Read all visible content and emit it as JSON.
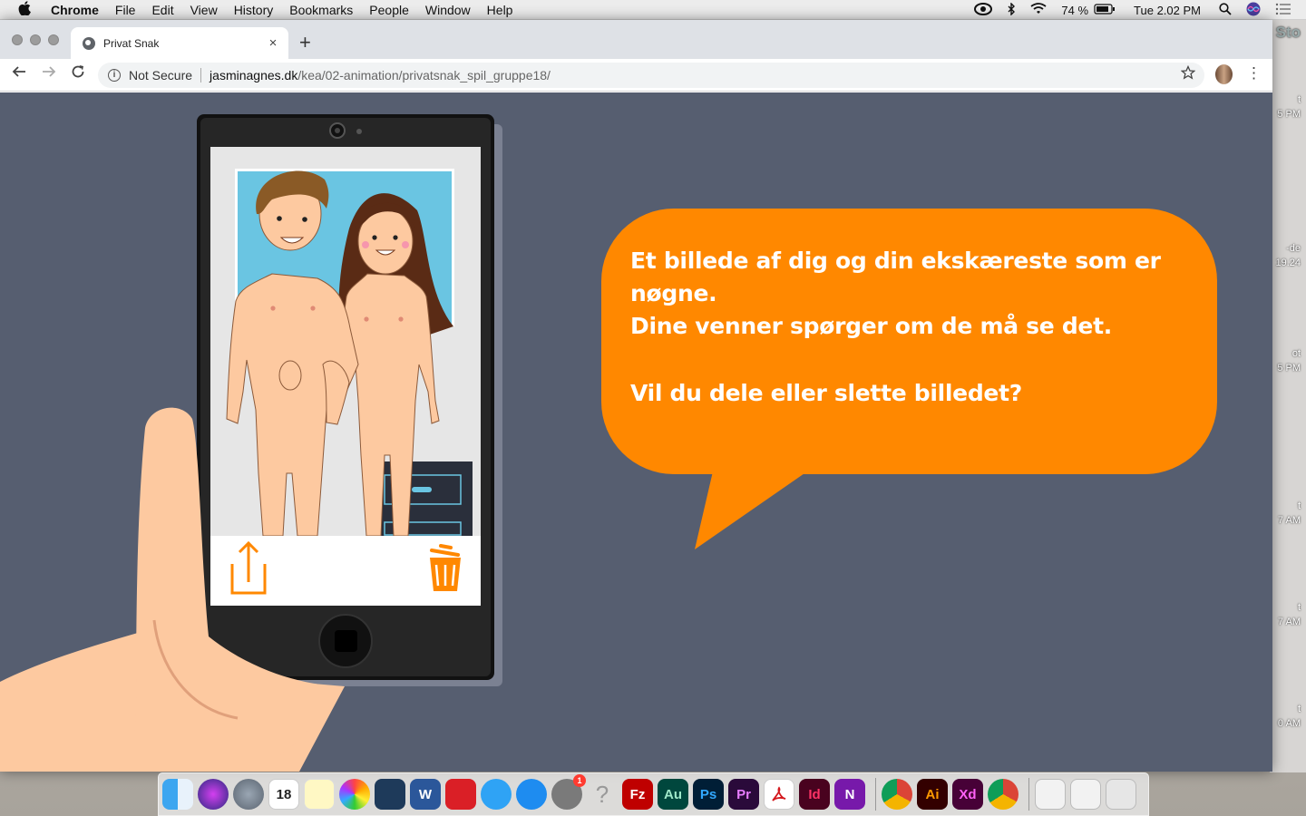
{
  "menubar": {
    "apple": "",
    "app_name": "Chrome",
    "items": [
      "File",
      "Edit",
      "View",
      "History",
      "Bookmarks",
      "People",
      "Window",
      "Help"
    ],
    "battery": "74 %",
    "clock": "Tue 2.02 PM"
  },
  "browser": {
    "tab_title": "Privat Snak",
    "new_tab": "+",
    "close_tab": "×",
    "security_label": "Not Secure",
    "url_host": "jasminagnes.dk",
    "url_path": "/kea/02-animation/privatsnak_spil_gruppe18/"
  },
  "page": {
    "bubble_line1": "Et billede af dig og din ekskæreste som er nøgne.",
    "bubble_line2": "Dine venner spørger om de må se det.",
    "bubble_question": "Vil du dele eller slette billedet?",
    "colors": {
      "background": "#565e70",
      "bubble": "#ff8800",
      "share_icon": "#ff8800",
      "trash_icon": "#ff8800",
      "photo_sky": "#6ac5e2",
      "skin": "#fdc9a0"
    },
    "actions": [
      "share-icon",
      "trash-icon"
    ]
  },
  "desktop": {
    "partial_labels": [
      "Sto",
      "t",
      "5 PM",
      "-de",
      "19.24",
      "ot",
      "5 PM",
      "t",
      "7 AM",
      "t",
      "7 AM",
      "t",
      "0 AM"
    ]
  },
  "dock": {
    "apps": [
      {
        "name": "finder-icon",
        "label": ""
      },
      {
        "name": "siri-icon",
        "label": ""
      },
      {
        "name": "launchpad-icon",
        "label": ""
      },
      {
        "name": "calendar-icon",
        "label": "18"
      },
      {
        "name": "notes-icon",
        "label": ""
      },
      {
        "name": "photos-icon",
        "label": ""
      },
      {
        "name": "scrivener-icon",
        "label": ""
      },
      {
        "name": "word-icon",
        "label": "W"
      },
      {
        "name": "creative-cloud-icon",
        "label": ""
      },
      {
        "name": "messages-icon",
        "label": ""
      },
      {
        "name": "app-store-icon",
        "label": ""
      },
      {
        "name": "system-preferences-icon",
        "label": "",
        "badge": "1"
      },
      {
        "name": "help-icon",
        "label": "?"
      },
      {
        "name": "filezilla-icon",
        "label": "Fz"
      },
      {
        "name": "audition-icon",
        "label": "Au"
      },
      {
        "name": "photoshop-icon",
        "label": "Ps"
      },
      {
        "name": "premiere-icon",
        "label": "Pr"
      },
      {
        "name": "acrobat-icon",
        "label": ""
      },
      {
        "name": "indesign-icon",
        "label": "Id"
      },
      {
        "name": "onenote-icon",
        "label": "N"
      },
      {
        "name": "chrome-icon",
        "label": ""
      },
      {
        "name": "illustrator-icon",
        "label": "Ai"
      },
      {
        "name": "xd-icon",
        "label": "Xd"
      },
      {
        "name": "chrome-canary-icon",
        "label": ""
      },
      {
        "name": "illustrator-doc-icon",
        "label": ""
      },
      {
        "name": "xd-doc-icon",
        "label": ""
      },
      {
        "name": "trash-bin-icon",
        "label": ""
      }
    ]
  }
}
